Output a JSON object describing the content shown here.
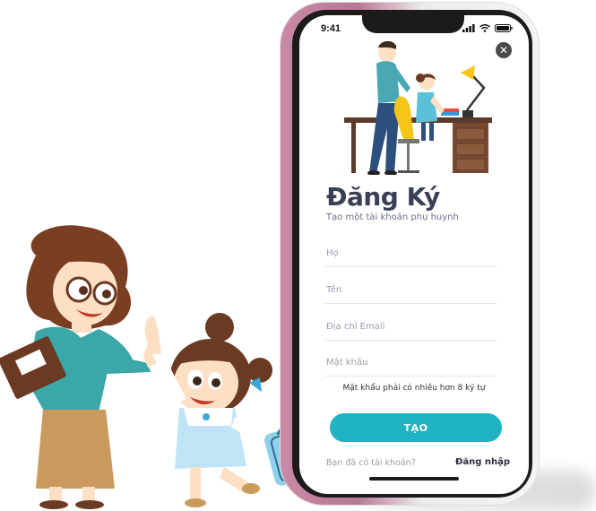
{
  "status_bar": {
    "time": "9:41"
  },
  "signup": {
    "title": "Đăng Ký",
    "subtitle": "Tạo một tài khoản phụ huynh",
    "fields": {
      "last_name_placeholder": "Họ",
      "first_name_placeholder": "Tên",
      "email_placeholder": "Địa chỉ Email",
      "password_placeholder": "Mật khẩu"
    },
    "password_hint": "Mật khẩu phải có nhiều hơn 8 ký tự",
    "submit_label": "TẠO",
    "login_prompt": "Bạn đã có tài khoản?",
    "login_link": "Đăng nhập"
  },
  "colors": {
    "accent": "#1fb3c3",
    "title": "#3b3f55",
    "frame": "#c98aa5"
  },
  "icons": [
    "signal-icon",
    "wifi-icon",
    "battery-icon",
    "close-icon"
  ]
}
